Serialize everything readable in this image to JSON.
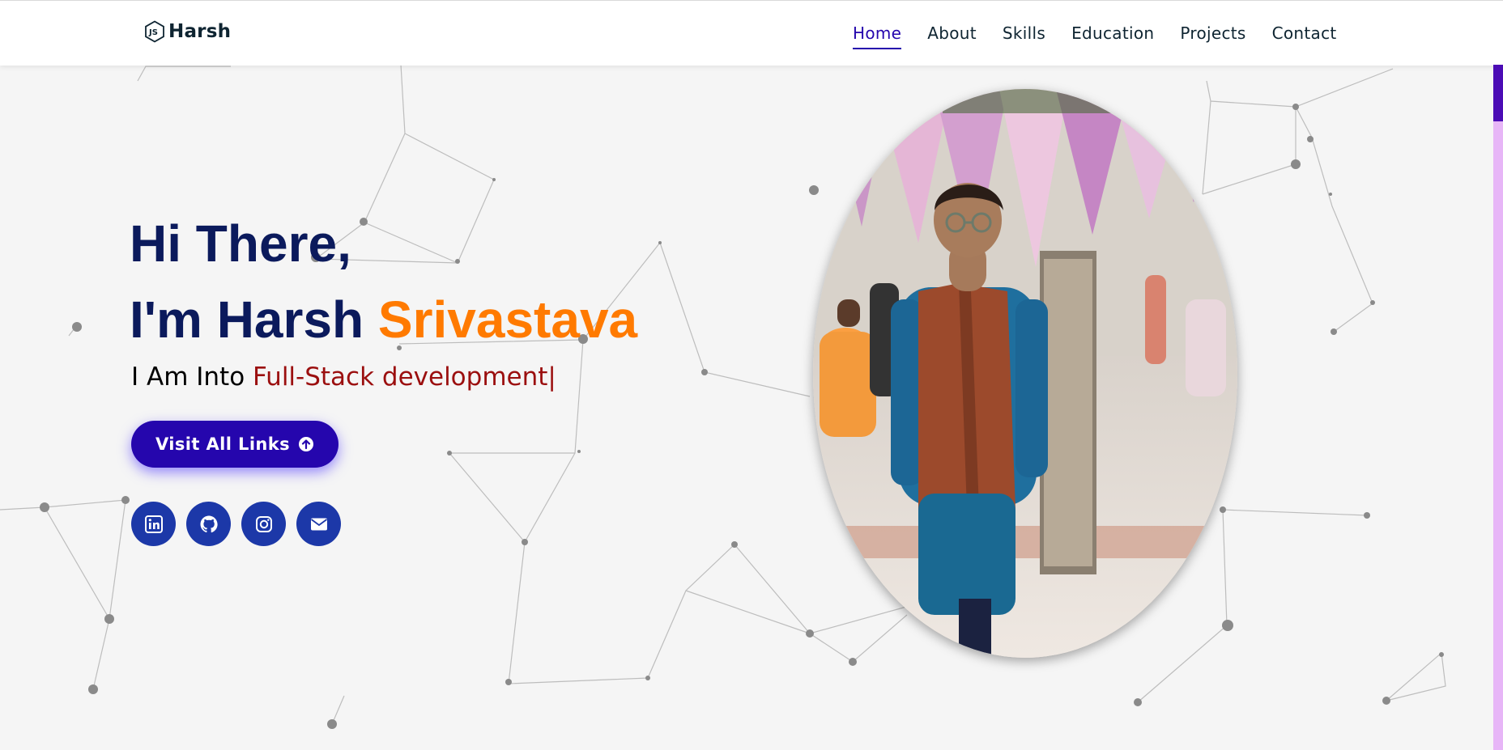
{
  "brand": {
    "name": "Harsh",
    "logo_icon": "nodejs-hexagon-icon"
  },
  "nav": {
    "items": [
      {
        "label": "Home",
        "active": true
      },
      {
        "label": "About",
        "active": false
      },
      {
        "label": "Skills",
        "active": false
      },
      {
        "label": "Education",
        "active": false
      },
      {
        "label": "Projects",
        "active": false
      },
      {
        "label": "Contact",
        "active": false
      }
    ]
  },
  "hero": {
    "greeting": "Hi There,",
    "intro_prefix": "I'm Harsh ",
    "intro_highlight": "Srivastava",
    "typing_prefix": "I Am Into ",
    "typing_text": "Full-Stack development|",
    "cta_label": "Visit All Links",
    "cta_icon": "arrow-circle-up-icon"
  },
  "socials": [
    {
      "name": "linkedin",
      "icon": "linkedin-icon"
    },
    {
      "name": "github",
      "icon": "github-icon"
    },
    {
      "name": "instagram",
      "icon": "instagram-icon"
    },
    {
      "name": "email",
      "icon": "envelope-icon"
    }
  ],
  "colors": {
    "primary": "#2506ad",
    "heading": "#0b1a5c",
    "accent_orange": "#ff7a00",
    "typed_red": "#9b0f0f",
    "social_bg": "#1c38a8",
    "page_bg": "#f5f5f5"
  }
}
